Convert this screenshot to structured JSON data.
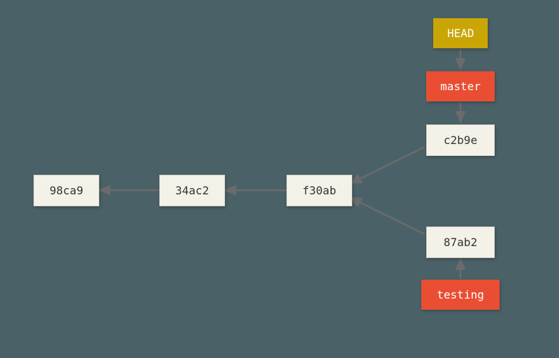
{
  "head": {
    "label": "HEAD"
  },
  "branches": {
    "master": {
      "label": "master"
    },
    "testing": {
      "label": "testing"
    }
  },
  "commits": {
    "c0": {
      "hash": "98ca9"
    },
    "c1": {
      "hash": "34ac2"
    },
    "c2": {
      "hash": "f30ab"
    },
    "c3": {
      "hash": "c2b9e"
    },
    "c4": {
      "hash": "87ab2"
    }
  },
  "colors": {
    "head": "#c9a506",
    "branch": "#e94e33",
    "commit_bg": "#f4f2e8",
    "arrow": "#6b6b6b",
    "canvas": "#4a6168"
  }
}
